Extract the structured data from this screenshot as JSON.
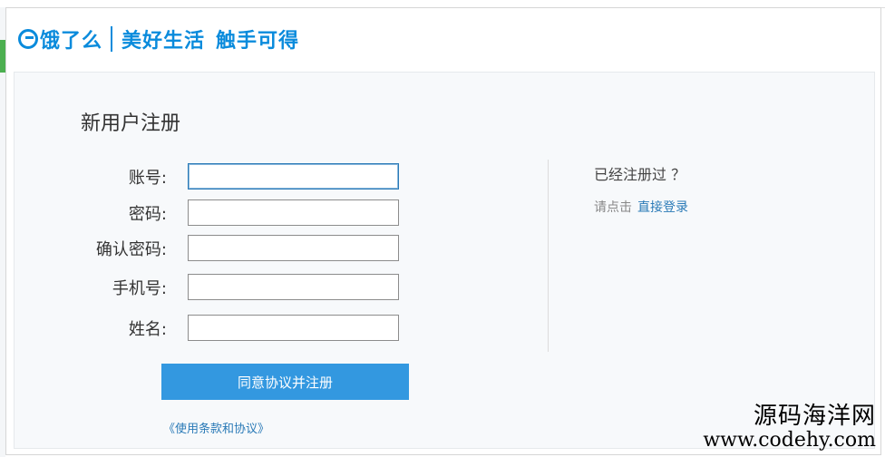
{
  "background": {
    "fragment_text": "",
    "fragment_small": ""
  },
  "header": {
    "logo_text": "饿了么",
    "slogan_parts": [
      "美好生活",
      "触手可得"
    ]
  },
  "form": {
    "title": "新用户注册",
    "fields": [
      {
        "label": "账号:",
        "value": "",
        "placeholder": ""
      },
      {
        "label": "密码:",
        "value": "",
        "placeholder": ""
      },
      {
        "label": "确认密码:",
        "value": "",
        "placeholder": ""
      },
      {
        "label": "手机号:",
        "value": "",
        "placeholder": ""
      },
      {
        "label": "姓名:",
        "value": "",
        "placeholder": ""
      }
    ],
    "submit_label": "同意协议并注册",
    "terms_link": "《使用条款和协议》"
  },
  "aside": {
    "question": "已经注册过 ？",
    "hint": "请点击",
    "login_link": "直接登录"
  },
  "watermark": {
    "line1": "源码海洋网",
    "line2": "www.codehy.com"
  },
  "colors": {
    "brand": "#0a8bdc",
    "button": "#3398e0",
    "link": "#2a7ab7",
    "panel_bg": "#f7f9fb"
  }
}
